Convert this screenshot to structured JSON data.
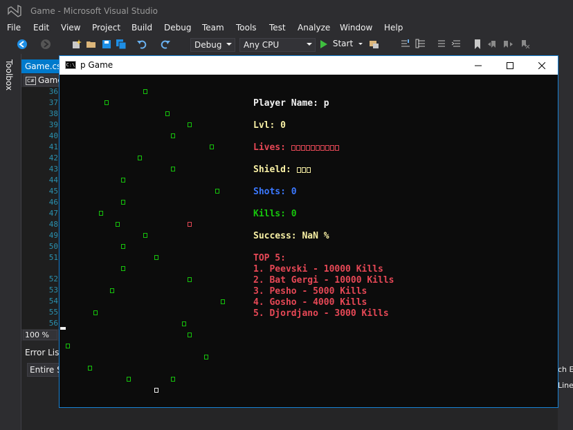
{
  "vs": {
    "window_title": "Game - Microsoft Visual Studio",
    "menu": [
      "File",
      "Edit",
      "View",
      "Project",
      "Build",
      "Debug",
      "Team",
      "Tools",
      "Test",
      "Analyze",
      "Window",
      "Help"
    ],
    "toolbar": {
      "config": "Debug",
      "platform": "Any CPU",
      "start_label": "Start"
    },
    "toolbox_label": "Toolbox",
    "doc_tab": "Game.cs",
    "nav_combo": "Game",
    "line_numbers": [
      "36",
      "37",
      "38",
      "39",
      "40",
      "41",
      "42",
      "43",
      "44",
      "45",
      "46",
      "47",
      "48",
      "49",
      "50",
      "51",
      "52",
      "53",
      "54",
      "55",
      "56"
    ],
    "zoom": "100 %",
    "error_list_title": "Error List",
    "error_scope": "Entire Solution",
    "right_frag_1": "ch E",
    "right_frag_2": "Line"
  },
  "console": {
    "title": "p Game",
    "icon_text": "C:\\",
    "player_name": "Player Name: p",
    "level": "Lvl: 0",
    "lives_label": "Lives: ",
    "lives_count": 10,
    "shield_label": "Shield: ",
    "shield_count": 3,
    "shots": "Shots: 0",
    "kills": "Kills: 0",
    "success": "Success: NaN %",
    "top_title": "TOP 5:",
    "top": [
      "1. Peevski - 10000 Kills",
      "2. Bat Gergi - 10000 Kills",
      "3. Pesho - 5000 Kills",
      "4. Gosho - 4000 Kills",
      "5. Djordjano - 3000 Kills"
    ],
    "colors": {
      "enemy": "#16c60c",
      "bomb": "#e74856",
      "player": "#f2f2f2",
      "accent": "#1883d7"
    }
  }
}
